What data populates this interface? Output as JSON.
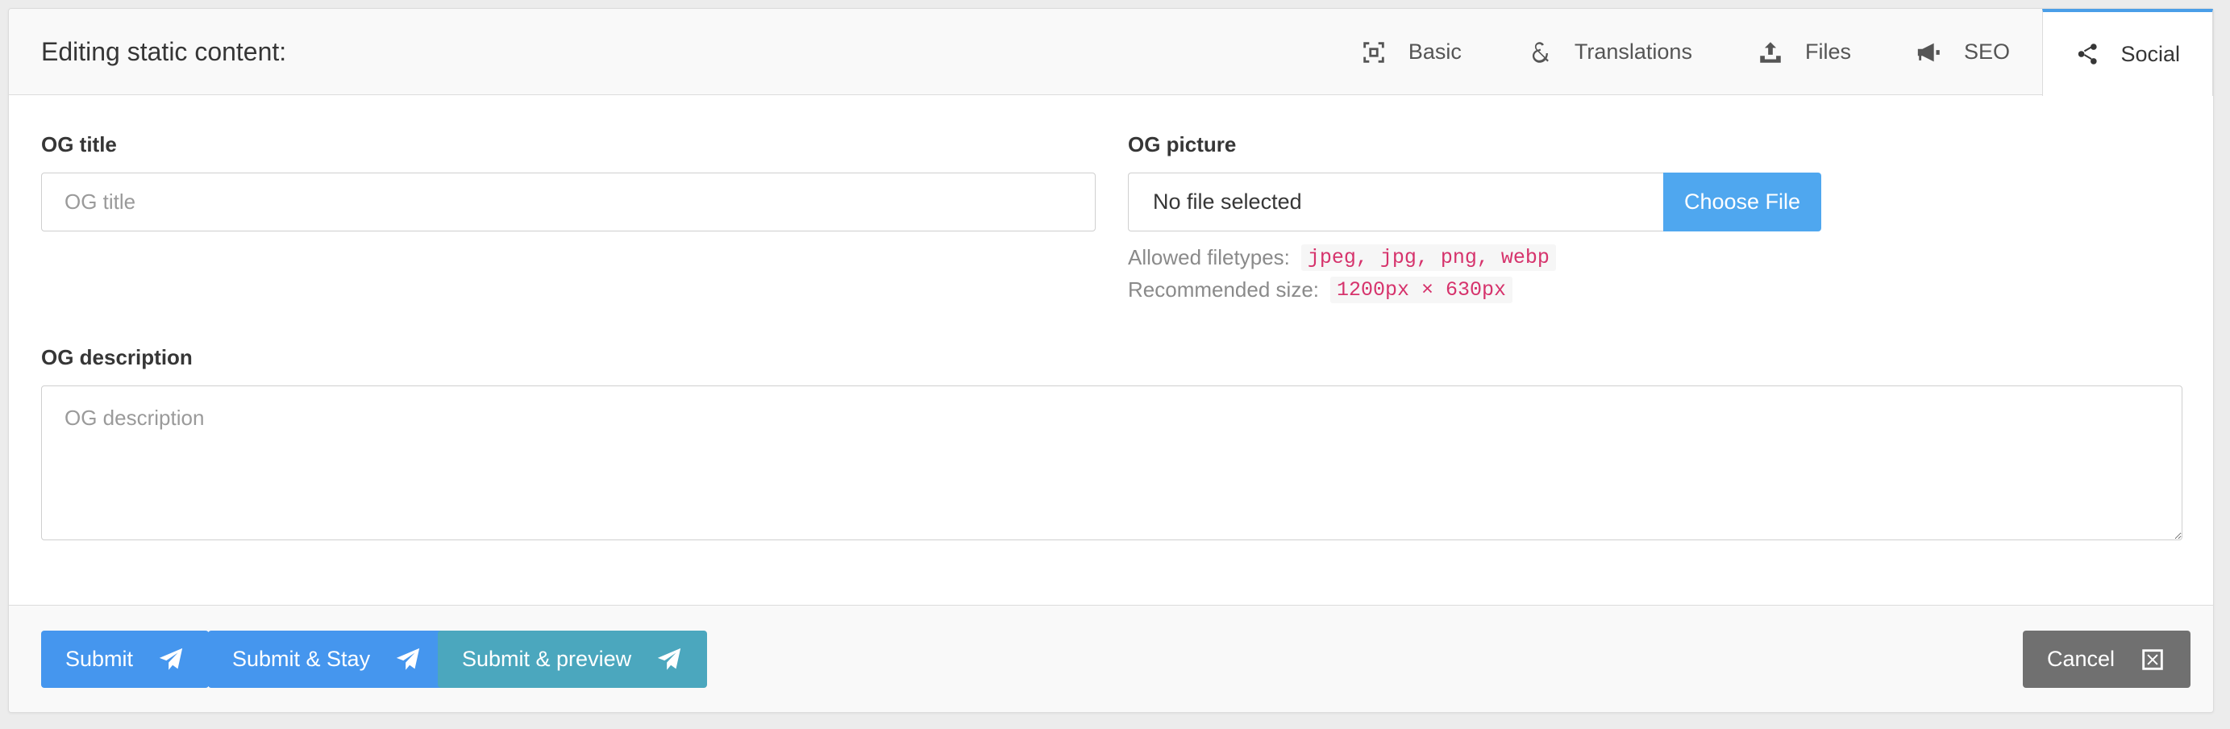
{
  "header": {
    "title": "Editing static content:",
    "tabs": [
      {
        "label": "Basic",
        "icon": "expand-icon"
      },
      {
        "label": "Translations",
        "icon": "ampersand-icon"
      },
      {
        "label": "Files",
        "icon": "upload-icon"
      },
      {
        "label": "SEO",
        "icon": "megaphone-icon"
      },
      {
        "label": "Social",
        "icon": "share-icon",
        "active": true
      }
    ]
  },
  "form": {
    "og_title": {
      "label": "OG title",
      "placeholder": "OG title",
      "value": ""
    },
    "og_picture": {
      "label": "OG picture",
      "file_status": "No file selected",
      "button_label": "Choose File",
      "allowed_label": "Allowed filetypes:",
      "allowed_types": "jpeg, jpg, png, webp",
      "size_label": "Recommended size:",
      "size_value": "1200px × 630px"
    },
    "og_description": {
      "label": "OG description",
      "placeholder": "OG description",
      "value": ""
    }
  },
  "footer": {
    "submit": "Submit",
    "submit_stay": "Submit & Stay",
    "submit_preview": "Submit & preview",
    "cancel": "Cancel"
  },
  "colors": {
    "primary": "#4596ee",
    "file_button": "#4fa7ef",
    "teal": "#4ba7be",
    "cancel": "#707070",
    "active_tab_border": "#4a9ee8",
    "code_text": "#d6336c"
  }
}
